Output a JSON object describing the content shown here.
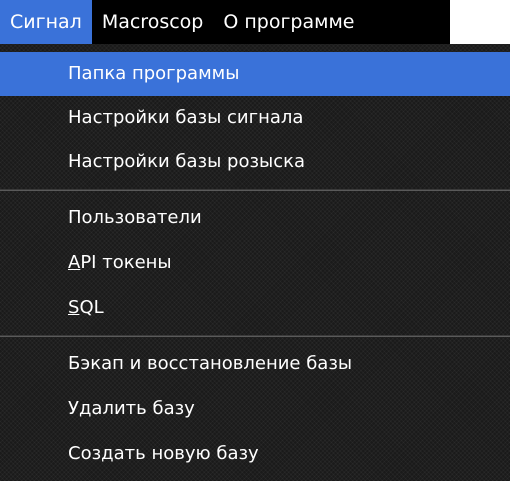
{
  "menubar": {
    "items": [
      {
        "label": "Сигнал"
      },
      {
        "label": "Macroscop"
      },
      {
        "label": "О программе"
      }
    ]
  },
  "dropdown": {
    "items": [
      {
        "label": "Папка программы"
      },
      {
        "label": "Настройки базы сигнала"
      },
      {
        "label": "Настройки базы розыска"
      },
      {
        "label": "Пользователи"
      },
      {
        "label_first": "A",
        "label_rest": "PI токены"
      },
      {
        "label_first": "S",
        "label_rest": "QL"
      },
      {
        "label": "Бэкап и восстановление базы"
      },
      {
        "label": "Удалить базу"
      },
      {
        "label": "Создать новую базу"
      }
    ]
  },
  "colors": {
    "menubar_bg": "#000000",
    "highlight": "#3a72d9",
    "dropdown_bg": "#1a1a1a",
    "text": "#ffffff"
  }
}
